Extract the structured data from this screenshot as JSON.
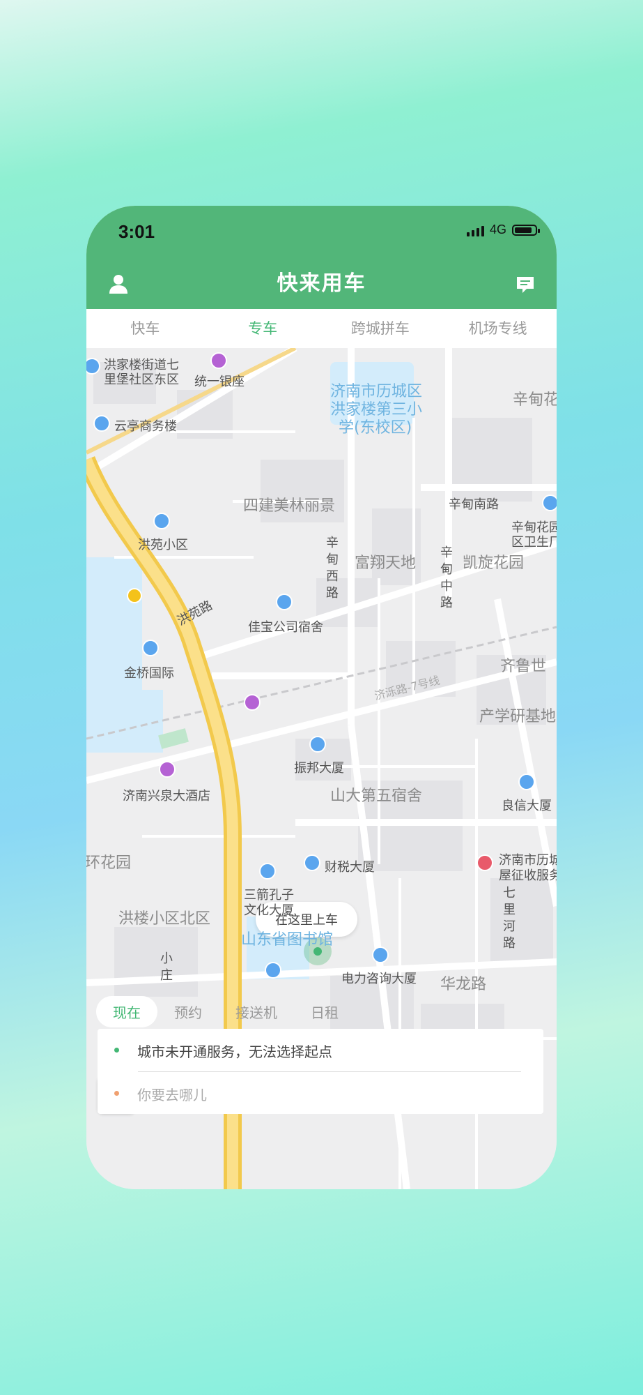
{
  "status_bar": {
    "time": "3:01",
    "network": "4G"
  },
  "header": {
    "title": "快来用车"
  },
  "tabs": [
    {
      "label": "快车",
      "active": false
    },
    {
      "label": "专车",
      "active": true
    },
    {
      "label": "跨城拼车",
      "active": false
    },
    {
      "label": "机场专线",
      "active": false
    }
  ],
  "map": {
    "labels": {
      "hongjialou_street": "洪家楼街道七",
      "hongjialou_street2": "里堡社区东区",
      "tongyi_yinzuo": "统一银座",
      "jinan_lixia_school": "济南市历城区",
      "jinan_lixia_school2": "洪家楼第三小",
      "jinan_lixia_school3": "学(东校区)",
      "xindian_top": "辛甸花",
      "yunting": "云亭商务楼",
      "sijian": "四建美林丽景",
      "xindian_nan": "辛甸南路",
      "xindian_huayuan": "辛甸花园",
      "xindian_huayuan2": "区卫生厂",
      "hongyuan_xiaoqu": "洪苑小区",
      "xindian_xi": "辛甸西路",
      "fuxiang": "富翔天地",
      "xindian_zhong": "辛甸中路",
      "kaixuan": "凯旋花园",
      "hongyuan_lu": "洪苑路",
      "jiabao": "佳宝公司宿舍",
      "qilu": "齐鲁世",
      "jinqiao": "金桥国际",
      "chanxue": "产学研基地",
      "pickup": "在这里上车",
      "zhenbang": "振邦大厦",
      "jinan_xingquan": "济南兴泉大酒店",
      "shanda": "山大第五宿舍",
      "liangxin": "良信大厦",
      "huanhuayuan": "环花园",
      "caishui": "财税大厦",
      "jinan_lifang": "济南市历城",
      "jinan_lifang2": "屋征收服务",
      "sanjian": "三箭孔子",
      "sanjian2": "文化大厦",
      "honglou": "洪楼小区北区",
      "library": "山东省图书馆",
      "qili_he": "七里河路",
      "dianli": "电力咨询大厦",
      "hualong": "华龙路",
      "xiaozhuang": "小庄",
      "rail": "济泺路-7号线"
    }
  },
  "modes": [
    {
      "label": "现在",
      "active": true
    },
    {
      "label": "预约",
      "active": false
    },
    {
      "label": "接送机",
      "active": false
    },
    {
      "label": "日租",
      "active": false
    }
  ],
  "panel": {
    "origin_text": "城市未开通服务，无法选择起点",
    "destination_placeholder": "你要去哪儿",
    "origin_dot_color": "#43b774",
    "destination_dot_color": "#f0a070"
  },
  "colors": {
    "brand": "#52b679",
    "accent": "#43b774"
  }
}
